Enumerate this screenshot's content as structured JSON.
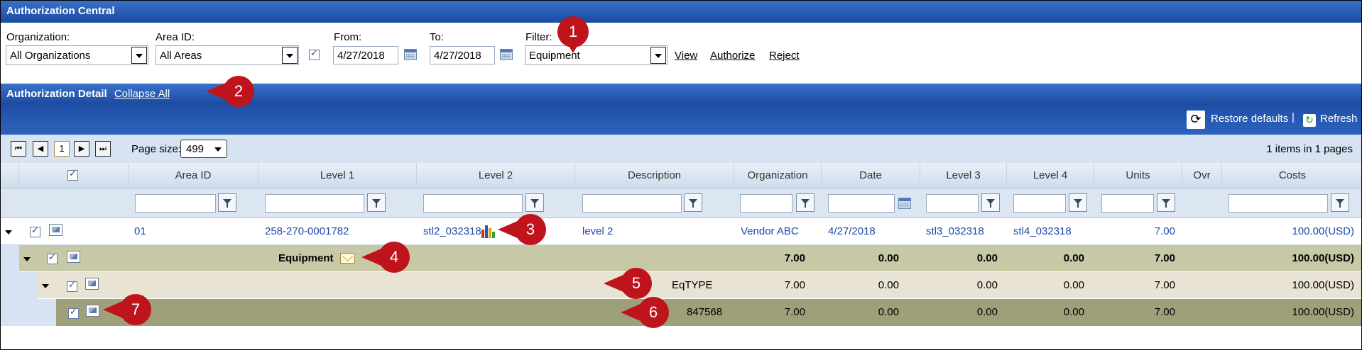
{
  "title": "Authorization Central",
  "filters": {
    "organization_label": "Organization:",
    "organization_value": "All Organizations",
    "area_label": "Area ID:",
    "area_value": "All Areas",
    "from_label": "From:",
    "from_value": "4/27/2018",
    "to_label": "To:",
    "to_value": "4/27/2018",
    "filter_label": "Filter:",
    "filter_value": "Equipment",
    "view": "View",
    "authorize": "Authorize",
    "reject": "Reject"
  },
  "detail": {
    "title": "Authorization Detail",
    "collapse_all": "Collapse All"
  },
  "toolbar": {
    "restore": "Restore defaults",
    "separator": "|",
    "refresh": "Refresh"
  },
  "pager": {
    "current_page": "1",
    "page_size_label": "Page size:",
    "page_size": "499",
    "info": "1 items in 1 pages"
  },
  "columns": [
    "Area ID",
    "Level 1",
    "Level 2",
    "Description",
    "Organization",
    "Date",
    "Level 3",
    "Level 4",
    "Units",
    "Ovr",
    "Costs"
  ],
  "row_main": {
    "area_id": "01",
    "level1": "258-270-0001782",
    "level2": "stl2_032318",
    "description": "level 2",
    "organization": "Vendor ABC",
    "date": "4/27/2018",
    "level3": "stl3_032318",
    "level4": "stl4_032318",
    "units": "7.00",
    "costs": "100.00(USD)"
  },
  "row_group": {
    "label": "Equipment",
    "v1": "7.00",
    "v2": "0.00",
    "v3": "0.00",
    "v4": "0.00",
    "units": "7.00",
    "costs": "100.00(USD)"
  },
  "row_type": {
    "label": "EqTYPE",
    "v1": "7.00",
    "v2": "0.00",
    "v3": "0.00",
    "v4": "0.00",
    "units": "7.00",
    "costs": "100.00(USD)"
  },
  "row_item": {
    "label": "847568",
    "v1": "7.00",
    "v2": "0.00",
    "v3": "0.00",
    "v4": "0.00",
    "units": "7.00",
    "costs": "100.00(USD)"
  },
  "callouts": [
    "1",
    "2",
    "3",
    "4",
    "5",
    "6",
    "7"
  ],
  "colors": {
    "group_row": "#c6c8a6",
    "type_row": "#e8e3d3",
    "item_row": "#9ea07a",
    "link_blue": "#1f4aa8",
    "callout_red": "#c0141c"
  }
}
